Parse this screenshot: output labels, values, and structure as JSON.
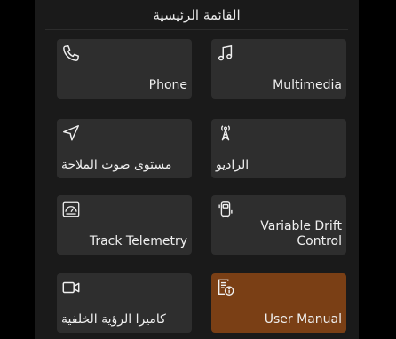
{
  "header": {
    "title": "القائمة الرئيسية"
  },
  "colors": {
    "tile": "#2e2e2e",
    "active": "#7a3f15",
    "background": "#1a1a1a"
  },
  "tiles": [
    {
      "label": "Phone",
      "icon": "phone-icon"
    },
    {
      "label": "Multimedia",
      "icon": "music-note-icon"
    },
    {
      "label": "مستوى صوت الملاحة",
      "icon": "navigation-arrow-icon"
    },
    {
      "label": "الراديو",
      "icon": "radio-tower-icon"
    },
    {
      "label": "Track Telemetry",
      "icon": "gauge-icon"
    },
    {
      "label": "Variable Drift Control",
      "icon": "car-drift-icon"
    },
    {
      "label": "كاميرا الرؤية الخلفية",
      "icon": "camera-icon"
    },
    {
      "label": "User Manual",
      "icon": "manual-info-icon",
      "selected": true
    }
  ]
}
